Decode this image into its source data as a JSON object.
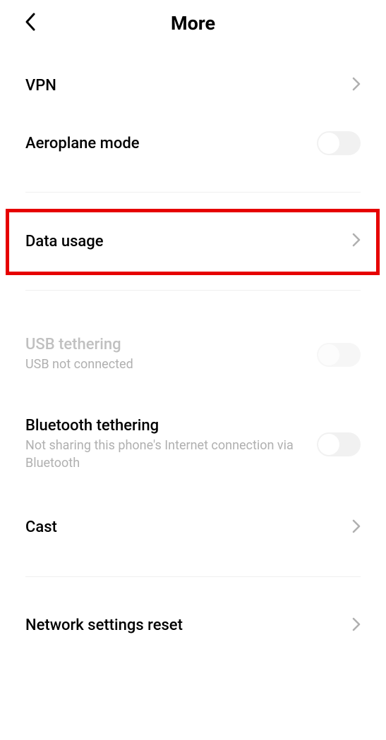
{
  "header": {
    "title": "More"
  },
  "items": {
    "vpn": {
      "label": "VPN"
    },
    "aeroplane": {
      "label": "Aeroplane mode",
      "enabled": false
    },
    "data_usage": {
      "label": "Data usage"
    },
    "usb_tethering": {
      "label": "USB tethering",
      "sub": "USB not connected",
      "enabled": false
    },
    "bt_tethering": {
      "label": "Bluetooth tethering",
      "sub": "Not sharing this phone's Internet connection via Bluetooth",
      "enabled": false
    },
    "cast": {
      "label": "Cast"
    },
    "network_reset": {
      "label": "Network settings reset"
    }
  },
  "highlight_color": "#e60000"
}
